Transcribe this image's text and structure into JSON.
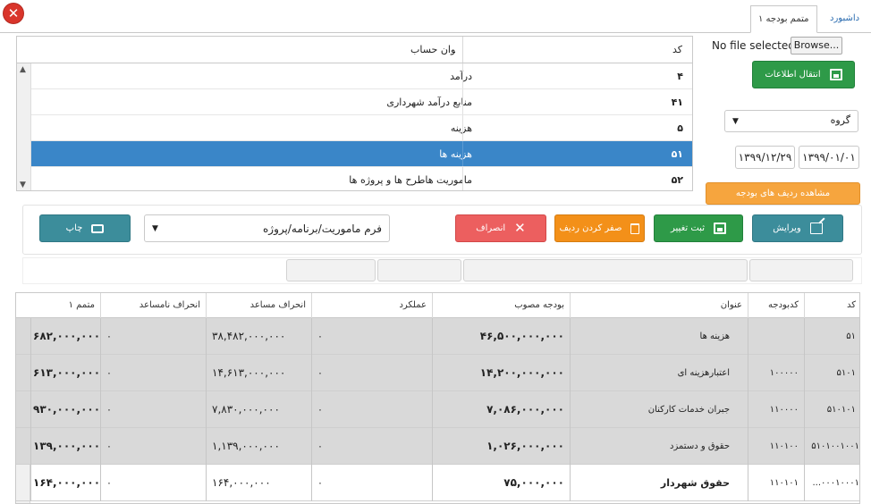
{
  "window": {
    "close_glyph": "✕"
  },
  "tabs": [
    {
      "label": "داشبورد",
      "active": false
    },
    {
      "label": "متمم بودجه ۱",
      "active": true
    }
  ],
  "account_table": {
    "headers": {
      "code": "کد",
      "title": "عنوان حساب"
    },
    "rows": [
      {
        "code": "۴",
        "title": "درآمد",
        "selected": false
      },
      {
        "code": "۴۱",
        "title": "منابع درآمد شهرداری",
        "selected": false
      },
      {
        "code": "۵",
        "title": "هزینه",
        "selected": false
      },
      {
        "code": "۵۱",
        "title": "هزینه ها",
        "selected": true
      },
      {
        "code": "۵۲",
        "title": "ماموریت هاطرح ها و پروژه ها",
        "selected": false
      }
    ]
  },
  "file_input": {
    "status": "No file selected.",
    "browse_label": "Browse..."
  },
  "transfer_button": "انتقال اطلاعات",
  "group_select": {
    "value": "گروه"
  },
  "dates": {
    "from": "۱۳۹۹/۰۱/۰۱",
    "to": "۱۳۹۹/۱۲/۲۹"
  },
  "view_budget_rows_button": "مشاهده ردیف های بودجه",
  "actions": {
    "edit": "ویرایش",
    "save": "ثبت تغییر",
    "zero": "صفر کردن ردیف",
    "cancel": "انصراف",
    "print": "چاپ"
  },
  "form_select": {
    "value": "فرم ماموریت/برنامه/پروژه"
  },
  "colors": {
    "selected_row": "#3a86c8",
    "green": "#2e9a48",
    "teal": "#3c8d9b",
    "red": "#ec5f5f",
    "orange": "#f39019",
    "amber": "#f6a53e"
  },
  "grid": {
    "headers": {
      "code": "کد",
      "budget_code": "کدبودجه",
      "title": "عنوان",
      "approved": "بودجه مصوب",
      "performance": "عملکرد",
      "pos_dev": "انحراف مساعد",
      "neg_dev": "انحراف نامساعد",
      "supplement": "متمم ۱"
    },
    "rows": [
      {
        "code": "۵۱",
        "budget_code": "",
        "title": "هزینه ها",
        "approved": "۴۶,۵۰۰,۰۰۰,۰۰۰",
        "performance": "۰",
        "pos_dev": "۳۸,۴۸۲,۰۰۰,۰۰۰",
        "neg_dev": "۰",
        "supplement": "۶۸۲,۰۰۰,۰۰۰",
        "shaded": true
      },
      {
        "code": "۵۱۰۱",
        "budget_code": "۱۰۰۰۰۰",
        "title": "اعتبارهزینه ای",
        "approved": "۱۴,۲۰۰,۰۰۰,۰۰۰",
        "performance": "۰",
        "pos_dev": "۱۴,۶۱۳,۰۰۰,۰۰۰",
        "neg_dev": "۰",
        "supplement": "۶۱۳,۰۰۰,۰۰۰",
        "shaded": true
      },
      {
        "code": "۵۱۰۱۰۱",
        "budget_code": "۱۱۰۰۰۰",
        "title": "جبران خدمات کارکنان",
        "approved": "۷,۰۸۶,۰۰۰,۰۰۰",
        "performance": "۰",
        "pos_dev": "۷,۸۳۰,۰۰۰,۰۰۰",
        "neg_dev": "۰",
        "supplement": "۹۳۰,۰۰۰,۰۰۰",
        "shaded": true
      },
      {
        "code": "۵۱۰۱۰۰۱۰۰۱",
        "budget_code": "۱۱۰۱۰۰",
        "title": "حقوق و دستمزد",
        "approved": "۱,۰۲۶,۰۰۰,۰۰۰",
        "performance": "۰",
        "pos_dev": "۱,۱۳۹,۰۰۰,۰۰۰",
        "neg_dev": "۰",
        "supplement": "۱۳۹,۰۰۰,۰۰۰",
        "shaded": true
      },
      {
        "code": "...۰۰۰۱۰۰۰۱",
        "budget_code": "۱۱۰۱۰۱",
        "title": "حقوق شهردار",
        "approved": "۷۵,۰۰۰,۰۰۰",
        "performance": "۰",
        "pos_dev": "۱۶۴,۰۰۰,۰۰۰",
        "neg_dev": "۰",
        "supplement": "۱۶۴,۰۰۰,۰۰۰",
        "shaded": false
      }
    ]
  }
}
